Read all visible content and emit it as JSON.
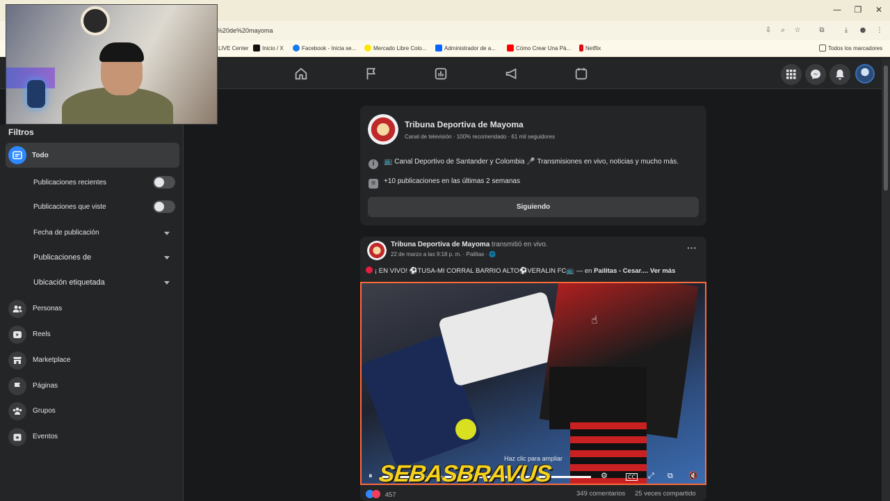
{
  "browser": {
    "url": "%20de%20mayoma",
    "bookmarks": [
      {
        "label": "LIVE Center",
        "color": "#e0e0e0"
      },
      {
        "label": "Inicio / X",
        "color": "#111111"
      },
      {
        "label": "Facebook - Inicia se...",
        "color": "#1877f2"
      },
      {
        "label": "Mercado Libre Colo...",
        "color": "#ffe600"
      },
      {
        "label": "Administrador de a...",
        "color": "#0866ff"
      },
      {
        "label": "Cómo Crear Una Pá...",
        "color": "#ff0000"
      },
      {
        "label": "Netflix",
        "color": "#e50914"
      }
    ],
    "all_bookmarks_label": "Todos los marcadores",
    "window_controls": [
      "—",
      "❐",
      "✕"
    ]
  },
  "sidebar": {
    "filters_title": "Filtros",
    "all_label": "Todo",
    "toggles": [
      {
        "label": "Publicaciones recientes",
        "on": false
      },
      {
        "label": "Publicaciones que viste",
        "on": false
      }
    ],
    "dropdowns": [
      "Fecha de publicación",
      "Publicaciones de",
      "Ubicación etiquetada"
    ],
    "categories": [
      {
        "label": "Personas",
        "icon": "people-icon"
      },
      {
        "label": "Reels",
        "icon": "reels-icon"
      },
      {
        "label": "Marketplace",
        "icon": "marketplace-icon"
      },
      {
        "label": "Páginas",
        "icon": "flag-icon"
      },
      {
        "label": "Grupos",
        "icon": "groups-icon"
      },
      {
        "label": "Eventos",
        "icon": "events-icon"
      }
    ]
  },
  "page_card": {
    "name": "Tribuna Deportiva de Mayoma",
    "subtitle": "Canal de televisión · 100% recomendado · 61 mil seguidores",
    "description": "📺 Canal Deportivo de Santander y Colombia 🎤 Transmisiones en vivo, noticias y mucho más.",
    "activity": "+10 publicaciones en las últimas 2 semanas",
    "follow_button": "Siguiendo"
  },
  "post": {
    "author": "Tribuna Deportiva de Mayoma",
    "action": "transmitió en vivo.",
    "date": "22 de marzo a las 9:18 p. m. · Pailitas · 🌐",
    "text": "¡ EN VIVO! ⚽TUSA-MI CORRAL BARRIO ALTO⚽VERALIN FC📺   — en ",
    "place": "Pailitas - Cesar",
    "more": ".... Ver más",
    "video_hint": "Haz clic para ampliar",
    "reactions": "457",
    "comments": "349 comentarios",
    "shares": "25 veces compartido",
    "progress": 1.0
  },
  "watermark": "SEBASBRAVUS",
  "colors": {
    "accent": "#2d88ff",
    "live": "#e41e3f"
  }
}
